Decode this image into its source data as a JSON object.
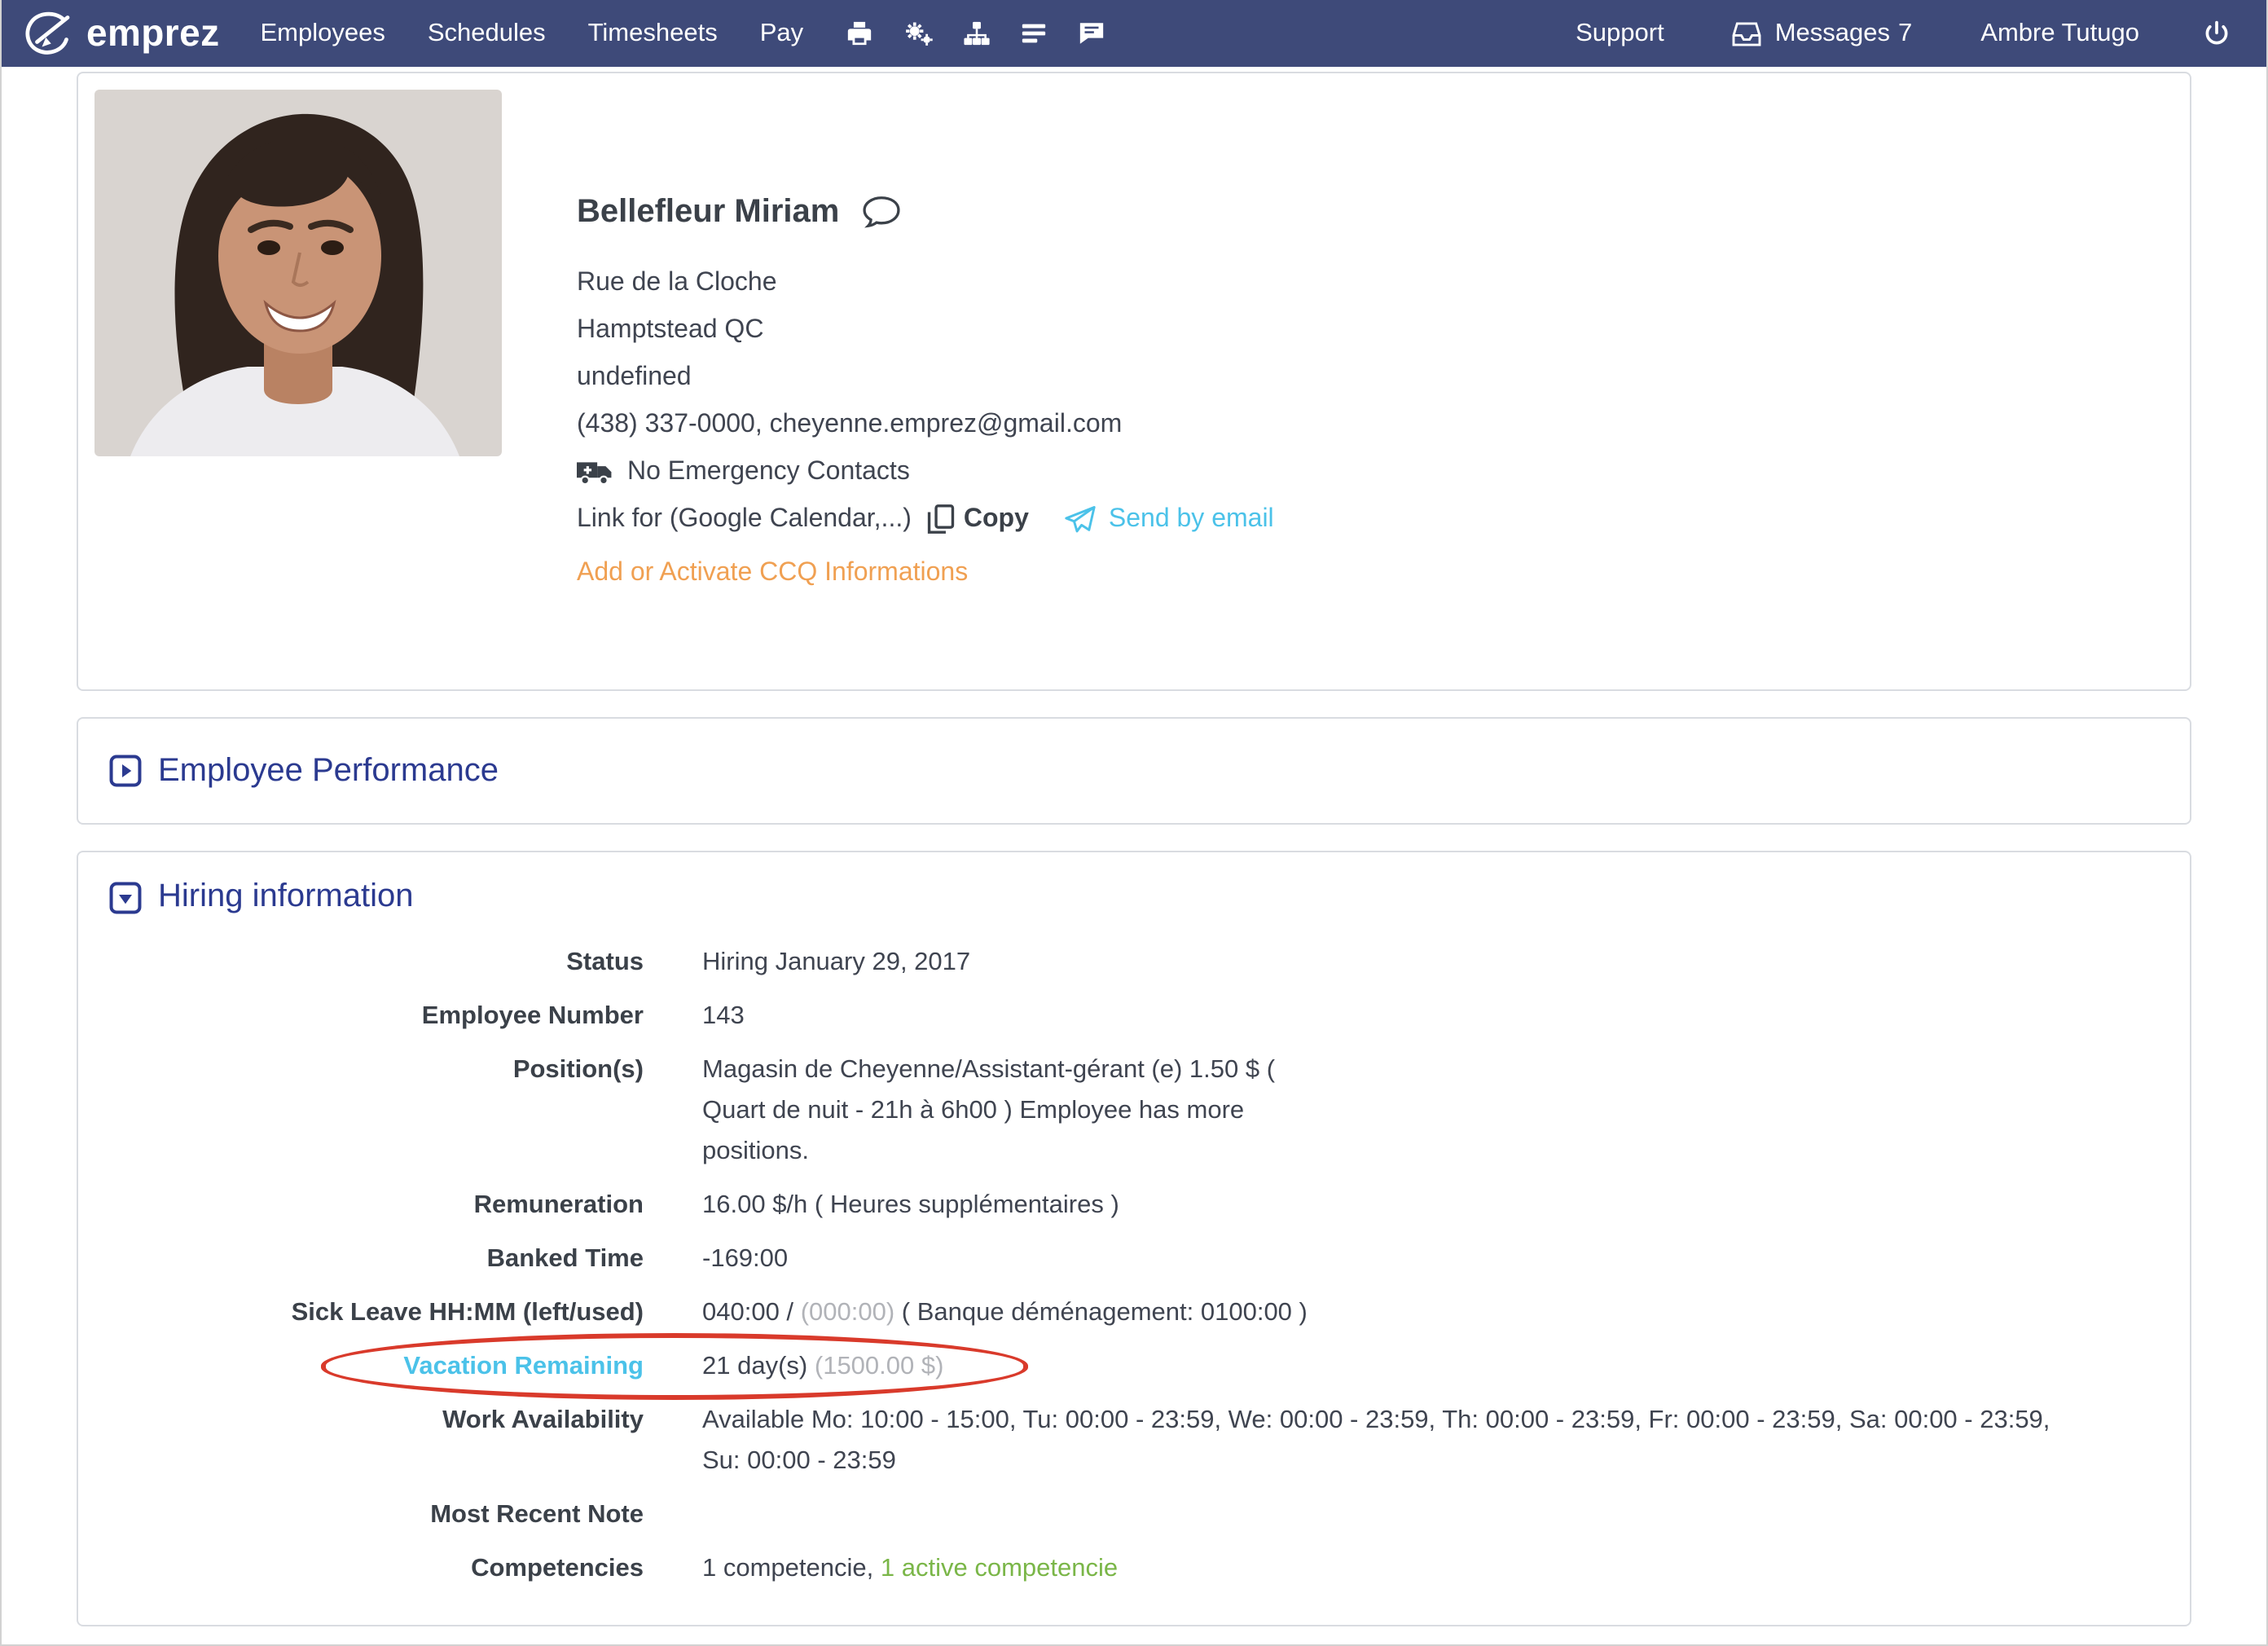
{
  "colors": {
    "navbar_bg": "#3e4a79",
    "heading_blue": "#2b3a90",
    "link_light_blue": "#4bc2e9",
    "orange_link": "#f0a052",
    "green_link": "#7ab648",
    "muted_gray": "#b1b3b8",
    "annotation_red": "#d93a2b"
  },
  "nav": {
    "brand": "emprez",
    "items": [
      {
        "label": "Employees"
      },
      {
        "label": "Schedules"
      },
      {
        "label": "Timesheets"
      },
      {
        "label": "Pay"
      }
    ],
    "icon_buttons": [
      "printer-icon",
      "gears-icon",
      "sitemap-icon",
      "list-icon",
      "chat-icon"
    ],
    "support_label": "Support",
    "messages_label": "Messages",
    "messages_count": "7",
    "user_name": "Ambre Tutugo"
  },
  "profile": {
    "name": "Bellefleur Miriam",
    "address_line_1": "Rue de la Cloche",
    "address_line_2": "Hamptstead QC",
    "address_line_3": "undefined",
    "phone_email": "(438) 337-0000, cheyenne.emprez@gmail.com",
    "emergency_contacts": "No Emergency Contacts",
    "calendar_link_label": "Link for (Google Calendar,...)",
    "copy_label": "Copy",
    "send_by_email_label": "Send by email",
    "ccq_link": "Add or Activate CCQ Informations"
  },
  "performance": {
    "title": "Employee Performance"
  },
  "hiring": {
    "title": "Hiring information",
    "status": {
      "label": "Status",
      "value": "Hiring January 29, 2017"
    },
    "employee_number": {
      "label": "Employee Number",
      "value": "143"
    },
    "positions": {
      "label": "Position(s)",
      "value": "Magasin de Cheyenne/Assistant-gérant (e) 1.50 $ ( Quart de nuit - 21h à 6h00 ) Employee has more positions."
    },
    "remuneration": {
      "label": "Remuneration",
      "value": "16.00 $/h ( Heures supplémentaires )"
    },
    "banked_time": {
      "label": "Banked Time",
      "value": "-169:00"
    },
    "sick_leave": {
      "label": "Sick Leave HH:MM (left/used)",
      "left": "040:00 /",
      "used": "(000:00)",
      "note": "( Banque déménagement: 0100:00 )"
    },
    "vacation": {
      "label": "Vacation Remaining",
      "days": "21 day(s)",
      "amount": "(1500.00 $)"
    },
    "work_availability": {
      "label": "Work Availability",
      "value": "Available Mo: 10:00 - 15:00, Tu: 00:00 - 23:59, We: 00:00 - 23:59, Th: 00:00 - 23:59, Fr: 00:00 - 23:59, Sa: 00:00 - 23:59, Su: 00:00 - 23:59"
    },
    "most_recent_note": {
      "label": "Most Recent Note",
      "value": ""
    },
    "competencies": {
      "label": "Competencies",
      "total": "1 competencie,",
      "active": "1 active competencie"
    }
  },
  "annotation": {
    "shape": "ellipse",
    "color": "#d93a2b",
    "target": "vacation-remaining-row"
  }
}
